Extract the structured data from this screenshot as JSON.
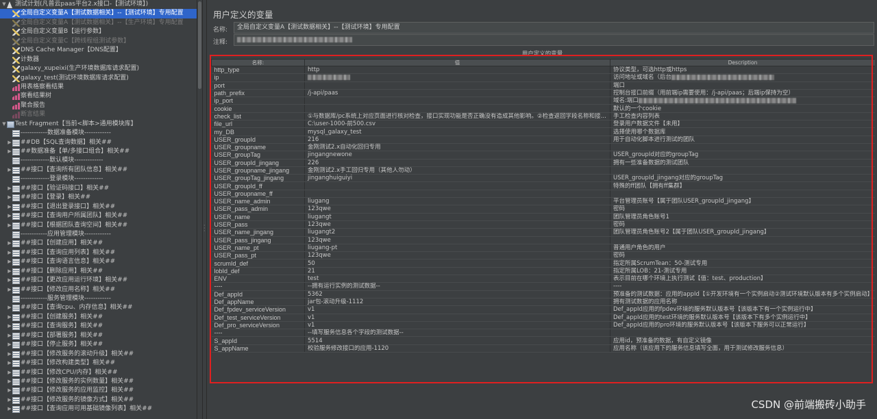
{
  "tree": {
    "items": [
      {
        "arrow": "▼",
        "icon": "plan",
        "indent": 0,
        "label": "测试计划(凡普云paas平台2.x接口-【测试环境】)",
        "selected": false,
        "disabled": false
      },
      {
        "arrow": "",
        "icon": "vars",
        "indent": 1,
        "label": "全局自定义变量A【测试数据相关】--【测试环境】专用配置",
        "selected": true,
        "disabled": false
      },
      {
        "arrow": "",
        "icon": "vars-off",
        "indent": 1,
        "label": "全局自定义变量A【测试数据相关】--【生产环境】专用配置",
        "selected": false,
        "disabled": true
      },
      {
        "arrow": "",
        "icon": "vars",
        "indent": 1,
        "label": "全局自定义变量B【运行参数】",
        "selected": false,
        "disabled": false
      },
      {
        "arrow": "",
        "icon": "vars-off",
        "indent": 1,
        "label": "全局自定义变量C【跨线程组测试参数】",
        "selected": false,
        "disabled": true
      },
      {
        "arrow": "",
        "icon": "vars",
        "indent": 1,
        "label": "DNS Cache Manager【DNS配置】",
        "selected": false,
        "disabled": false
      },
      {
        "arrow": "",
        "icon": "vars",
        "indent": 1,
        "label": "计数器",
        "selected": false,
        "disabled": false
      },
      {
        "arrow": "",
        "icon": "vars",
        "indent": 1,
        "label": "galaxy_xupeixi(生产环境数据库请求配置)",
        "selected": false,
        "disabled": false
      },
      {
        "arrow": "",
        "icon": "vars",
        "indent": 1,
        "label": "galaxy_test(测试环境数据库请求配置)",
        "selected": false,
        "disabled": false
      },
      {
        "arrow": "",
        "icon": "chart",
        "indent": 1,
        "label": "用表格察看结果",
        "selected": false,
        "disabled": false
      },
      {
        "arrow": "",
        "icon": "chart",
        "indent": 1,
        "label": "察看结果树",
        "selected": false,
        "disabled": false
      },
      {
        "arrow": "",
        "icon": "chart",
        "indent": 1,
        "label": "聚合报告",
        "selected": false,
        "disabled": false
      },
      {
        "arrow": "",
        "icon": "chart-off",
        "indent": 1,
        "label": "断言结果",
        "selected": false,
        "disabled": true
      },
      {
        "arrow": "▼",
        "icon": "lib",
        "indent": 0,
        "label": "Test Fragment【当前<脚本>通用模块库】",
        "selected": false,
        "disabled": false
      },
      {
        "arrow": "",
        "icon": "list",
        "indent": 1,
        "label": "------------数据准备模块------------",
        "selected": false,
        "disabled": false
      },
      {
        "arrow": "▶",
        "icon": "list",
        "indent": 1,
        "label": "##DB【SQL查询数据】相关##",
        "selected": false,
        "disabled": false
      },
      {
        "arrow": "▶",
        "icon": "list",
        "indent": 1,
        "label": "##数据准备【单/多接口组合】相关##",
        "selected": false,
        "disabled": false
      },
      {
        "arrow": "",
        "icon": "list",
        "indent": 1,
        "label": "-------------默认模块-------------",
        "selected": false,
        "disabled": false
      },
      {
        "arrow": "▶",
        "icon": "list",
        "indent": 1,
        "label": "##接口【查询所有团队信息】相关##",
        "selected": false,
        "disabled": false
      },
      {
        "arrow": "",
        "icon": "list",
        "indent": 1,
        "label": "-------------登录模块-------------",
        "selected": false,
        "disabled": false
      },
      {
        "arrow": "▶",
        "icon": "list",
        "indent": 1,
        "label": "##接口【验证码接口】相关##",
        "selected": false,
        "disabled": false
      },
      {
        "arrow": "▶",
        "icon": "list",
        "indent": 1,
        "label": "##接口【登录】相关##",
        "selected": false,
        "disabled": false
      },
      {
        "arrow": "▶",
        "icon": "list",
        "indent": 1,
        "label": "##接口【退出登录接口】相关##",
        "selected": false,
        "disabled": false
      },
      {
        "arrow": "▶",
        "icon": "list",
        "indent": 1,
        "label": "##接口【查询用户所属团队】相关##",
        "selected": false,
        "disabled": false
      },
      {
        "arrow": "▶",
        "icon": "list",
        "indent": 1,
        "label": "##接口【根据团队查询空间】相关##",
        "selected": false,
        "disabled": false
      },
      {
        "arrow": "",
        "icon": "list",
        "indent": 1,
        "label": "------------应用管理模块------------",
        "selected": false,
        "disabled": false
      },
      {
        "arrow": "▶",
        "icon": "list",
        "indent": 1,
        "label": "##接口【创建应用】相关##",
        "selected": false,
        "disabled": false
      },
      {
        "arrow": "▶",
        "icon": "list",
        "indent": 1,
        "label": "##接口【查询应用列表】相关##",
        "selected": false,
        "disabled": false
      },
      {
        "arrow": "▶",
        "icon": "list",
        "indent": 1,
        "label": "##接口【查询语言信息】相关##",
        "selected": false,
        "disabled": false
      },
      {
        "arrow": "▶",
        "icon": "list",
        "indent": 1,
        "label": "##接口【删除应用】相关##",
        "selected": false,
        "disabled": false
      },
      {
        "arrow": "▶",
        "icon": "list",
        "indent": 1,
        "label": "##接口【更改应用运行环境】相关##",
        "selected": false,
        "disabled": false
      },
      {
        "arrow": "▶",
        "icon": "list",
        "indent": 1,
        "label": "##接口【修改应用名称】相关##",
        "selected": false,
        "disabled": false
      },
      {
        "arrow": "",
        "icon": "list",
        "indent": 1,
        "label": "------------服务管理模块------------",
        "selected": false,
        "disabled": false
      },
      {
        "arrow": "▶",
        "icon": "list",
        "indent": 1,
        "label": "##接口【查询cpu、内存信息】相关##",
        "selected": false,
        "disabled": false
      },
      {
        "arrow": "▶",
        "icon": "list",
        "indent": 1,
        "label": "##接口【创建服务】相关##",
        "selected": false,
        "disabled": false
      },
      {
        "arrow": "▶",
        "icon": "list",
        "indent": 1,
        "label": "##接口【查询服务】相关##",
        "selected": false,
        "disabled": false
      },
      {
        "arrow": "▶",
        "icon": "list",
        "indent": 1,
        "label": "##接口【部署服务】相关##",
        "selected": false,
        "disabled": false
      },
      {
        "arrow": "▶",
        "icon": "list",
        "indent": 1,
        "label": "##接口【停止服务】相关##",
        "selected": false,
        "disabled": false
      },
      {
        "arrow": "▶",
        "icon": "list",
        "indent": 1,
        "label": "##接口【修改服务的滚动升级】相关##",
        "selected": false,
        "disabled": false
      },
      {
        "arrow": "▶",
        "icon": "list",
        "indent": 1,
        "label": "##接口【修改构建类型】相关##",
        "selected": false,
        "disabled": false
      },
      {
        "arrow": "▶",
        "icon": "list",
        "indent": 1,
        "label": "##接口【修改CPU/内存】相关##",
        "selected": false,
        "disabled": false
      },
      {
        "arrow": "▶",
        "icon": "list",
        "indent": 1,
        "label": "##接口【修改服务的实例数量】相关##",
        "selected": false,
        "disabled": false
      },
      {
        "arrow": "▶",
        "icon": "list",
        "indent": 1,
        "label": "##接口【修改服务的应用监控】相关##",
        "selected": false,
        "disabled": false
      },
      {
        "arrow": "▶",
        "icon": "list",
        "indent": 1,
        "label": "##接口【修改服务的镜像方式】相关##",
        "selected": false,
        "disabled": false
      },
      {
        "arrow": "▶",
        "icon": "list",
        "indent": 1,
        "label": "##接口【查询应用可用基础镜像列表】相关##",
        "selected": false,
        "disabled": false
      }
    ]
  },
  "panel": {
    "title": "用户定义的变量",
    "name_label": "名称:",
    "name_value": "全局自定义变量A【测试数据相关】--【测试环境】专用配置",
    "comment_label": "注释:",
    "table_title": "用户定义的变量",
    "columns": [
      "名称:",
      "值",
      "Description"
    ],
    "rows": [
      [
        "http_type",
        "http",
        "协议类型，可选http或https"
      ],
      [
        "ip",
        "",
        "访问地址或域名（后台"
      ],
      [
        "port",
        "",
        "端口"
      ],
      [
        "path_prefix",
        "/j-api/paas",
        "控制台接口前缀（用前端ip需要使用：/j-api/paas；后端ip保持为空）"
      ],
      [
        "ip_port",
        "",
        "域名:端口"
      ],
      [
        "cookie",
        "",
        "默认的一个cookie"
      ],
      [
        "check_list",
        "①与数据库/pc系统上对应页面进行核对检查，接口实现功能是否正确没有造成其他影响。②检查返回字段名称和接...",
        "手工检查内容列表"
      ],
      [
        "file_url",
        "C:\\user-1000-前500.csv",
        "登录用户数据文件【未用】"
      ],
      [
        "my_DB",
        "mysql_galaxy_test",
        "选择使用哪个数据库"
      ],
      [
        "USER_groupId",
        "216",
        "用于自动化脚本进行测试的团队"
      ],
      [
        "USER_groupname",
        "金刚测试2.x自动化回归专用",
        ""
      ],
      [
        "USER_groupTag",
        "jingangnewone",
        "USER_groupId对应的groupTag"
      ],
      [
        "USER_groupId_jingang",
        "226",
        "拥有一些准备数据的测试团队"
      ],
      [
        "USER_groupname_jingang",
        "金刚测试2.x手工回归专用（其他人勿动）",
        ""
      ],
      [
        "USER_groupTag_jingang",
        "jinganghuiguiyi",
        "USER_groupId_jingang对应的groupTag"
      ],
      [
        "USER_groupId_ff",
        "",
        "特殊的ff团队【拥有ff集群】"
      ],
      [
        "USER_groupname_ff",
        "",
        ""
      ],
      [
        "USER_name_admin",
        "liugang",
        "平台管理员账号【属于团队USER_groupId_jingang】"
      ],
      [
        "USER_pass_admin",
        "123qwe",
        "密码"
      ],
      [
        "USER_name",
        "liugangt",
        "团队管理员角色账号1"
      ],
      [
        "USER_pass",
        "123qwe",
        "密码"
      ],
      [
        "USER_name_jingang",
        "liugangt2",
        "团队管理员角色账号2【属于团队USER_groupId_jingang】"
      ],
      [
        "USER_pass_jingang",
        "123qwe",
        ""
      ],
      [
        "USER_name_pt",
        "liugang-pt",
        "普通用户角色的用户"
      ],
      [
        "USER_pass_pt",
        "123qwe",
        "密码"
      ],
      [
        "scrumId_def",
        "50",
        "指定所属ScrumTean：50-测试专用"
      ],
      [
        "lobId_def",
        "21",
        "指定所属LOB：21-测试专用"
      ],
      [
        "ENV",
        "test",
        "表示目前在哪个环境上执行测试【值：test、production】"
      ],
      [
        "----",
        "--拥有运行实例的测试数据--",
        "----"
      ],
      [
        "Def_appId",
        "5362",
        "预准备的测试数据：应用的appId【①开发环境有一个实例启动②测试环境默认版本有多个实例启动】"
      ],
      [
        "Def_appName",
        "jar包-滚动升级-1112",
        "拥有测试数据的应用名称"
      ],
      [
        "Def_fpdev_serviceVersion",
        "v1",
        "Def_appId应用的fpdev环境的服务默认版本号【该版本下有一个实例运行中】"
      ],
      [
        "Def_test_serviceVersion",
        "v1",
        "Def_appId应用的test环境的服务默认版本号【该版本下有多个实例运行中】"
      ],
      [
        "Def_pro_serviceVersion",
        "v1",
        "Def_appId应用的pro环境的服务默认版本号【该版本下服务可以正常运行】"
      ],
      [
        "----",
        "--填写服务信息各个字段的测试数据--",
        ""
      ],
      [
        "S_appId",
        "5514",
        "应用id，预准备的数据，有自定义镜像"
      ],
      [
        "S_appName",
        "校验服务修改接口的应用-1120",
        "应用名称（该应用下的服务信息填写全面，用于测试修改服务信息）"
      ]
    ]
  },
  "watermark": "CSDN @前端搬砖小助手",
  "colors": {
    "selection": "#2f65ca",
    "highlight_box": "#e02020",
    "background": "#3c3f41"
  }
}
